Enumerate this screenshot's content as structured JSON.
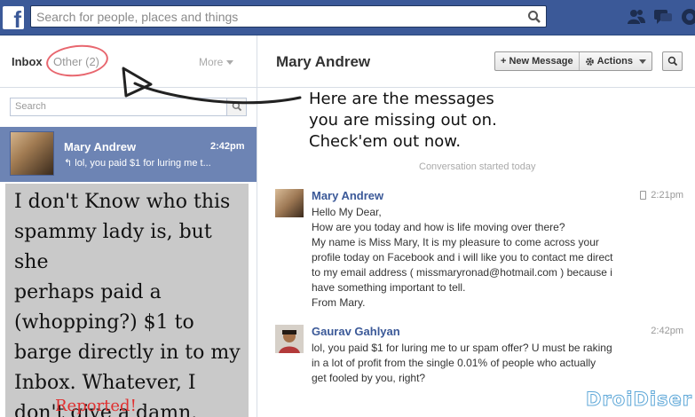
{
  "topbar": {
    "logo": "f",
    "search_placeholder": "Search for people, places and things",
    "icons": [
      "friends-icon",
      "messages-icon",
      "notifications-icon"
    ]
  },
  "sidebar": {
    "tab_inbox": "Inbox",
    "tab_other": "Other (2)",
    "tab_more": "More",
    "search_placeholder": "Search",
    "threads": [
      {
        "name": "Mary Andrew",
        "time": "2:42pm",
        "snippet": "↰ lol, you paid $1 for luring me t..."
      }
    ]
  },
  "overlay": {
    "note_lines": [
      "I don't Know who this",
      "spammy lady is, but she",
      "perhaps paid a",
      "(whopping?) $1 to",
      "barge directly in to my",
      "Inbox. Whatever, I",
      "don't give a damn."
    ],
    "reported": "Reported!",
    "annotation_lines": [
      "Here are the messages",
      "you are missing out on.",
      "Check'em out now."
    ],
    "watermark": "DroiDiser"
  },
  "conversation": {
    "title": "Mary Andrew",
    "new_message_label": "New Message",
    "actions_label": "Actions",
    "started_label": "Conversation started today",
    "messages": [
      {
        "name": "Mary Andrew",
        "time": "2:21pm",
        "lines": [
          "Hello My Dear,",
          "How are you today and how is life moving over there?",
          "My name is Miss Mary, It is my pleasure to come across your",
          "profile today on Facebook and i will like you to contact me direct",
          "to my email address ( missmaryronad@hotmail.com ) because i",
          "have something important to tell.",
          "From Mary."
        ]
      },
      {
        "name": "Gaurav Gahlyan",
        "time": "2:42pm",
        "lines": [
          "lol, you paid $1 for luring me to ur spam offer? U must be raking",
          "in a lot of profit from the single 0.01% of people who actually",
          "get fooled by you, right?"
        ]
      }
    ]
  },
  "colors": {
    "brand": "#3b5998",
    "selected_thread": "#6d84b4",
    "annotation_circle": "#e8676f",
    "reported_text": "#e03030"
  }
}
